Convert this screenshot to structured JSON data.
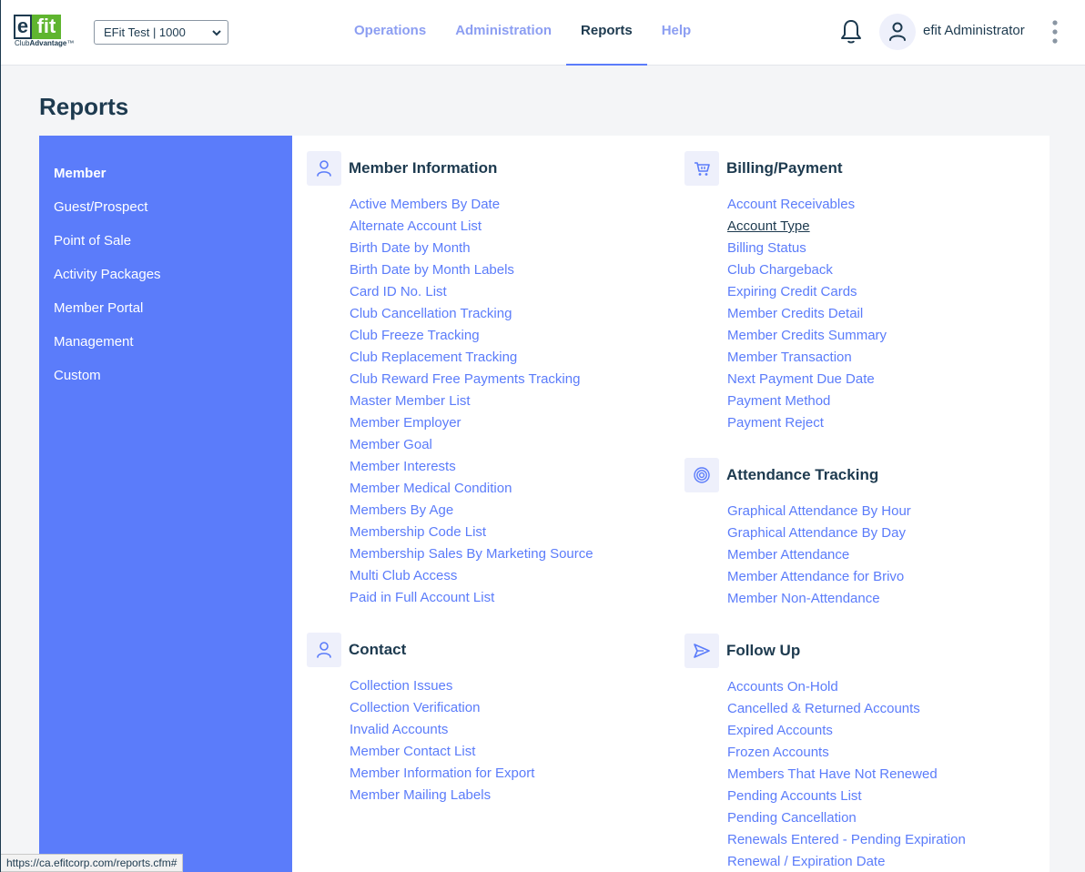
{
  "logo": {
    "e": "e",
    "fit": "fit",
    "sub_plain": "Club",
    "sub_bold": "Advantage",
    "tm": "™"
  },
  "club_select": {
    "value": "EFit Test | 1000"
  },
  "nav": [
    {
      "label": "Operations"
    },
    {
      "label": "Administration"
    },
    {
      "label": "Reports"
    },
    {
      "label": "Help"
    }
  ],
  "user": {
    "name": "efit Administrator"
  },
  "page": {
    "title": "Reports"
  },
  "sidebar": {
    "items": [
      {
        "label": "Member"
      },
      {
        "label": "Guest/Prospect"
      },
      {
        "label": "Point of Sale"
      },
      {
        "label": "Activity Packages"
      },
      {
        "label": "Member Portal"
      },
      {
        "label": "Management"
      },
      {
        "label": "Custom"
      }
    ]
  },
  "sections": {
    "member_information": {
      "title": "Member Information",
      "icon": "person-icon",
      "links": [
        "Active Members By Date",
        "Alternate Account List",
        "Birth Date by Month",
        "Birth Date by Month Labels",
        "Card ID No. List",
        "Club Cancellation Tracking",
        "Club Freeze Tracking",
        "Club Replacement Tracking",
        "Club Reward Free Payments Tracking",
        "Master Member List",
        "Member Employer",
        "Member Goal",
        "Member Interests",
        "Member Medical Condition",
        "Members By Age",
        "Membership Code List",
        "Membership Sales By Marketing Source",
        "Multi Club Access",
        "Paid in Full Account List"
      ]
    },
    "contact": {
      "title": "Contact",
      "icon": "person-icon",
      "links": [
        "Collection Issues",
        "Collection Verification",
        "Invalid Accounts",
        "Member Contact List",
        "Member Information for Export",
        "Member Mailing Labels"
      ]
    },
    "billing_payment": {
      "title": "Billing/Payment",
      "icon": "cart-icon",
      "links": [
        "Account Receivables",
        "Account Type",
        "Billing Status",
        "Club Chargeback",
        "Expiring Credit Cards",
        "Member Credits Detail",
        "Member Credits Summary",
        "Member Transaction",
        "Next Payment Due Date",
        "Payment Method",
        "Payment Reject"
      ]
    },
    "attendance_tracking": {
      "title": "Attendance Tracking",
      "icon": "target-icon",
      "links": [
        "Graphical Attendance By Hour",
        "Graphical Attendance By Day",
        "Member Attendance",
        "Member Attendance for Brivo",
        "Member Non-Attendance"
      ]
    },
    "follow_up": {
      "title": "Follow Up",
      "icon": "send-icon",
      "links": [
        "Accounts On-Hold",
        "Cancelled & Returned Accounts",
        "Expired Accounts",
        "Frozen Accounts",
        "Members That Have Not Renewed",
        "Pending Accounts List",
        "Pending Cancellation",
        "Renewals Entered - Pending Expiration",
        "Renewal / Expiration Date"
      ]
    }
  },
  "statusbar": {
    "url": "https://ca.efitcorp.com/reports.cfm#"
  },
  "colors": {
    "accent": "#5b7cfa",
    "text_dark": "#1d3a4f",
    "logo_green": "#5fb52f"
  }
}
